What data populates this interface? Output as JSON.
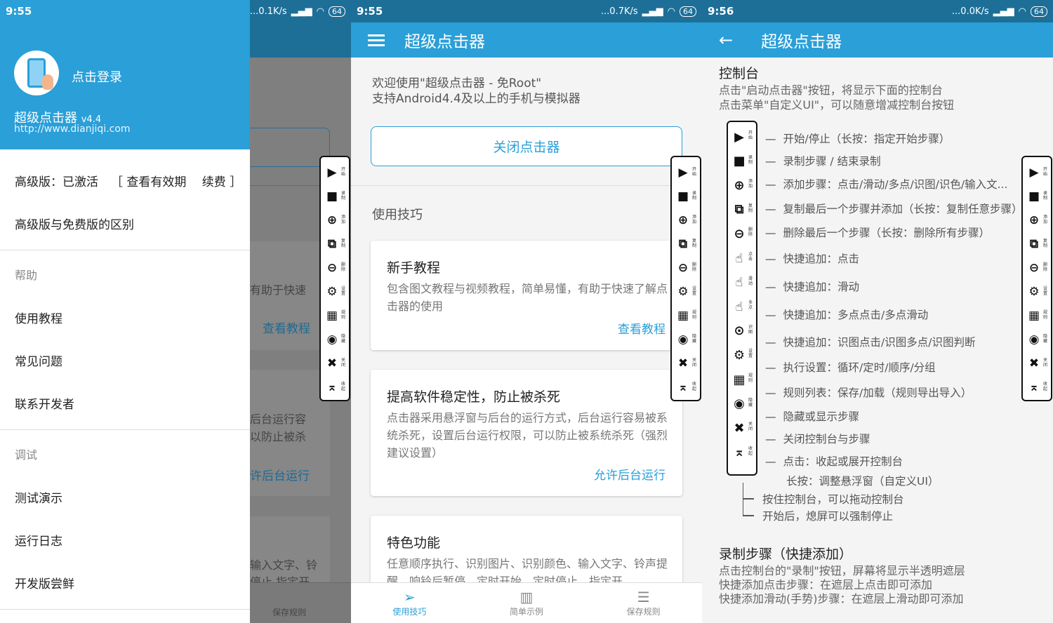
{
  "status_bars": [
    {
      "time": "9:55",
      "speed": "...0.1K/s",
      "battery": "64"
    },
    {
      "time": "9:55",
      "speed": "...0.7K/s",
      "battery": "64"
    },
    {
      "time": "9:56",
      "speed": "...0.0K/s",
      "battery": "64"
    }
  ],
  "drawer": {
    "login": "点击登录",
    "app_name": "超级点击器",
    "version": "v4.4",
    "url": "http://www.dianjiqi.com",
    "premium_status": "高级版：已激活",
    "premium_actions": "［ 查看有效期　 续费 ］",
    "diff": "高级版与免费版的区别",
    "section_help": "帮助",
    "help_items": [
      "使用教程",
      "常见问题",
      "联系开发者"
    ],
    "section_debug": "调试",
    "debug_items": [
      "测试演示",
      "运行日志",
      "开发版尝鲜"
    ]
  },
  "behind": {
    "text1": "有助于快速",
    "link1": "查看教程",
    "text2": "后台运行容",
    "text3": "以防止被杀",
    "link2": "许后台运行",
    "text4": "输入文字、铃",
    "text5": "停止 指定开",
    "nav": "保存规则"
  },
  "control_bar": {
    "items": [
      {
        "icon": "play-icon",
        "glyph": "▶",
        "label": "开始"
      },
      {
        "icon": "record-icon",
        "glyph": "■",
        "label": "录制"
      },
      {
        "icon": "add-icon",
        "glyph": "⊕",
        "label": "添加"
      },
      {
        "icon": "copy-icon",
        "glyph": "⧉",
        "label": "复制"
      },
      {
        "icon": "remove-icon",
        "glyph": "⊖",
        "label": "删除"
      },
      {
        "icon": "gear-icon",
        "glyph": "⚙",
        "label": "设置"
      },
      {
        "icon": "rules-icon",
        "glyph": "▦",
        "label": "规则"
      },
      {
        "icon": "hide-icon",
        "glyph": "◉",
        "label": "隐藏"
      },
      {
        "icon": "close-icon",
        "glyph": "✖",
        "label": "关闭"
      },
      {
        "icon": "collapse-icon",
        "glyph": "⌅",
        "label": "收起"
      }
    ]
  },
  "main": {
    "title": "超级点击器",
    "welcome1": "欢迎使用\"超级点击器 - 免Root\"",
    "welcome2": "支持Android4.4及以上的手机与模拟器",
    "close_button": "关闭点击器",
    "tips_header": "使用技巧",
    "cards": [
      {
        "title": "新手教程",
        "desc": "包含图文教程与视频教程，简单易懂，有助于快速了解点击器的使用",
        "action": "查看教程"
      },
      {
        "title": "提高软件稳定性，防止被杀死",
        "desc": "点击器采用悬浮窗与后台的运行方式，后台运行容易被系统杀死，设置后台运行权限，可以防止被系统杀死（强烈建议设置）",
        "action": "允许后台运行"
      },
      {
        "title": "特色功能",
        "desc": "任意顺序执行、识别图片、识别颜色、输入文字、铃声提醒、响铃后暂停、定时开始、定时停止、指定开",
        "action": ""
      }
    ],
    "bottom_nav": [
      {
        "icon": "send-icon",
        "glyph": "➢",
        "label": "使用技巧",
        "active": true
      },
      {
        "icon": "chart-icon",
        "glyph": "▥",
        "label": "简单示例",
        "active": false
      },
      {
        "icon": "list-icon",
        "glyph": "☰",
        "label": "保存规则",
        "active": false
      }
    ]
  },
  "help": {
    "title": "超级点击器",
    "console_title": "控制台",
    "console_desc1": "点击\"启动点击器\"按钮，将显示下面的控制台",
    "console_desc2": "点击菜单\"自定义UI\"，可以随意增减控制台按钮",
    "legend": [
      "开始/停止（长按：指定开始步骤）",
      "录制步骤 / 结束录制",
      "添加步骤：点击/滑动/多点/识图/识色/输入文...",
      "复制最后一个步骤并添加（长按：复制任意步骤）",
      "删除最后一个步骤（长按：删除所有步骤）",
      "快捷追加：点击",
      "快捷追加：滑动",
      "快捷追加：多点点击/多点滑动",
      "快捷追加：识图点击/识图多点/识图判断",
      "执行设置：循环/定时/顺序/分组",
      "规则列表：保存/加载（规则导出导入）",
      "隐藏或显示步骤",
      "关闭控制台与步骤",
      "点击：收起或展开控制台"
    ],
    "legend_last_line2": "长按：调整悬浮窗（自定义UI）",
    "legend_icons": [
      {
        "icon": "play-icon",
        "glyph": "▶",
        "label": "开始"
      },
      {
        "icon": "record-icon",
        "glyph": "■",
        "label": "录制"
      },
      {
        "icon": "add-icon",
        "glyph": "⊕",
        "label": "添加"
      },
      {
        "icon": "copy-icon",
        "glyph": "⧉",
        "label": "复制"
      },
      {
        "icon": "remove-icon",
        "glyph": "⊖",
        "label": "删除"
      },
      {
        "icon": "tap-icon",
        "glyph": "☝",
        "label": "点击"
      },
      {
        "icon": "swipe-icon",
        "glyph": "☝",
        "label": "滑动"
      },
      {
        "icon": "multi-tap-icon",
        "glyph": "☝",
        "label": "多点"
      },
      {
        "icon": "image-search-icon",
        "glyph": "⊙",
        "label": "识图"
      },
      {
        "icon": "gear-icon",
        "glyph": "⚙",
        "label": "设置"
      },
      {
        "icon": "rules-icon",
        "glyph": "▦",
        "label": "规则"
      },
      {
        "icon": "hide-icon",
        "glyph": "◉",
        "label": "隐藏"
      },
      {
        "icon": "close-icon",
        "glyph": "✖",
        "label": "关闭"
      },
      {
        "icon": "collapse-icon",
        "glyph": "⌅",
        "label": "收起"
      }
    ],
    "tree1": "按住控制台，可以拖动控制台",
    "tree2": "开始后，熄屏可以强制停止",
    "record_title": "录制步骤（快捷添加）",
    "record_desc1": "点击控制台的\"录制\"按钮，屏幕将显示半透明遮层",
    "record_desc2": "快捷添加点击步骤：在遮层上点击即可添加",
    "record_desc3": "快捷添加滑动(手势)步骤：在遮层上滑动即可添加"
  }
}
